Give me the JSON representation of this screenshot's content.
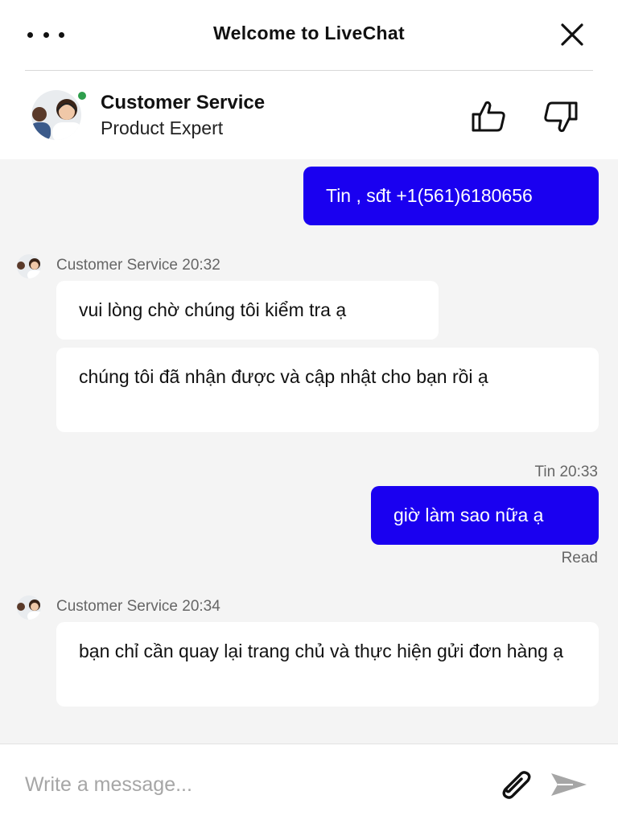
{
  "header": {
    "title": "Welcome to LiveChat",
    "menu_icon": "more-dots-icon",
    "close_icon": "close-icon"
  },
  "agent": {
    "name": "Customer Service",
    "role": "Product Expert",
    "status": "online",
    "status_color": "#2e9e4c"
  },
  "colors": {
    "outgoing_bubble": "#1a00f0",
    "incoming_bubble": "#ffffff",
    "background": "#f4f4f4"
  },
  "messages": [
    {
      "direction": "out",
      "text": "Tin , sđt +1(561)6180656"
    },
    {
      "direction": "in",
      "header": "Customer Service 20:32",
      "texts": [
        "vui lòng chờ chúng tôi kiểm tra ạ",
        "chúng tôi đã nhận được và cập nhật cho bạn rồi ạ"
      ]
    },
    {
      "direction": "out",
      "header": "Tin 20:33",
      "text": "giờ làm sao nữa ạ",
      "receipt": "Read"
    },
    {
      "direction": "in",
      "header": "Customer Service 20:34",
      "texts": [
        "bạn chỉ cần quay lại trang chủ và thực hiện gửi đơn hàng ạ"
      ]
    }
  ],
  "composer": {
    "placeholder": "Write a message...",
    "value": "",
    "attach_icon": "paperclip-icon",
    "send_icon": "send-icon"
  }
}
